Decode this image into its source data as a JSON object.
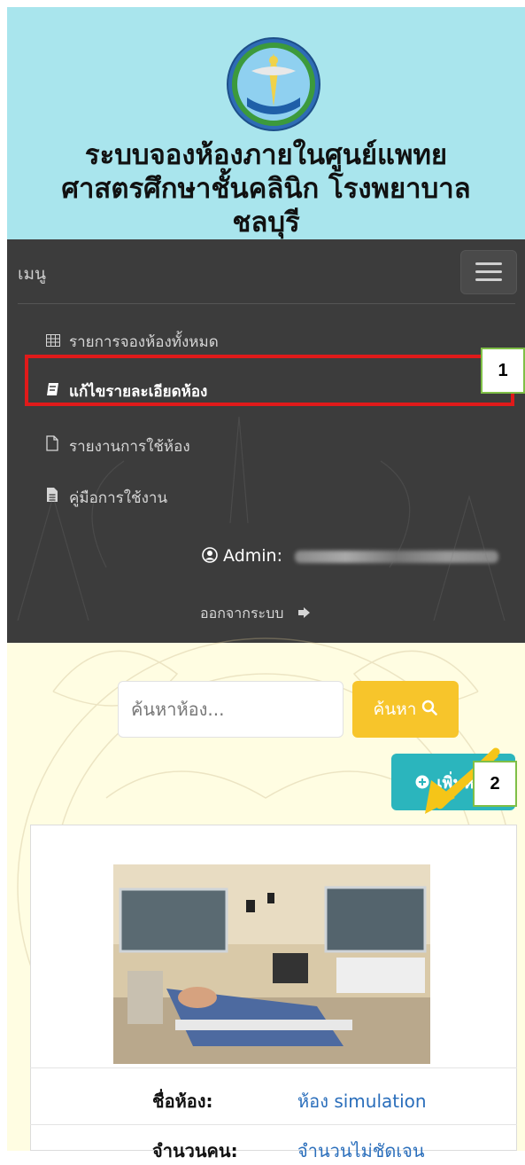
{
  "header": {
    "title_line1": "ระบบจองห้องภายในศูนย์แพทย",
    "title_line2": "ศาสตรศึกษาชั้นคลินิก โรงพยาบาล",
    "title_line3": "ชลบุรี"
  },
  "navbar": {
    "menu_label": "เมนู",
    "items": [
      {
        "label": "รายการจองห้องทั้งหมด",
        "icon": "table-icon"
      },
      {
        "label": "แก้ไขรายละเอียดห้อง",
        "icon": "book-icon",
        "active": true
      },
      {
        "label": "รายงานการใช้ห้อง",
        "icon": "file-icon"
      },
      {
        "label": "คู่มือการใช้งาน",
        "icon": "file-text-icon"
      }
    ],
    "admin_label": "Admin:",
    "logout_label": "ออกจากระบบ"
  },
  "annotations": {
    "badge1": "1",
    "badge2": "2"
  },
  "search": {
    "placeholder": "ค้นหาห้อง...",
    "button_label": "ค้นหา"
  },
  "add_button_label": "เพิ่มห้อง",
  "room": {
    "name_label": "ชื่อห้อง:",
    "name_value": "ห้อง simulation",
    "capacity_label": "จำนวนคน:",
    "capacity_value": "จำนวนไม่ชัดเจน"
  },
  "colors": {
    "header_bg": "#a9e5ed",
    "navbar_bg": "#3c3c3c",
    "search_button": "#f7c52b",
    "add_button": "#2bb5bd",
    "highlight_box": "#e01a1a",
    "arrow": "#f5c518"
  }
}
